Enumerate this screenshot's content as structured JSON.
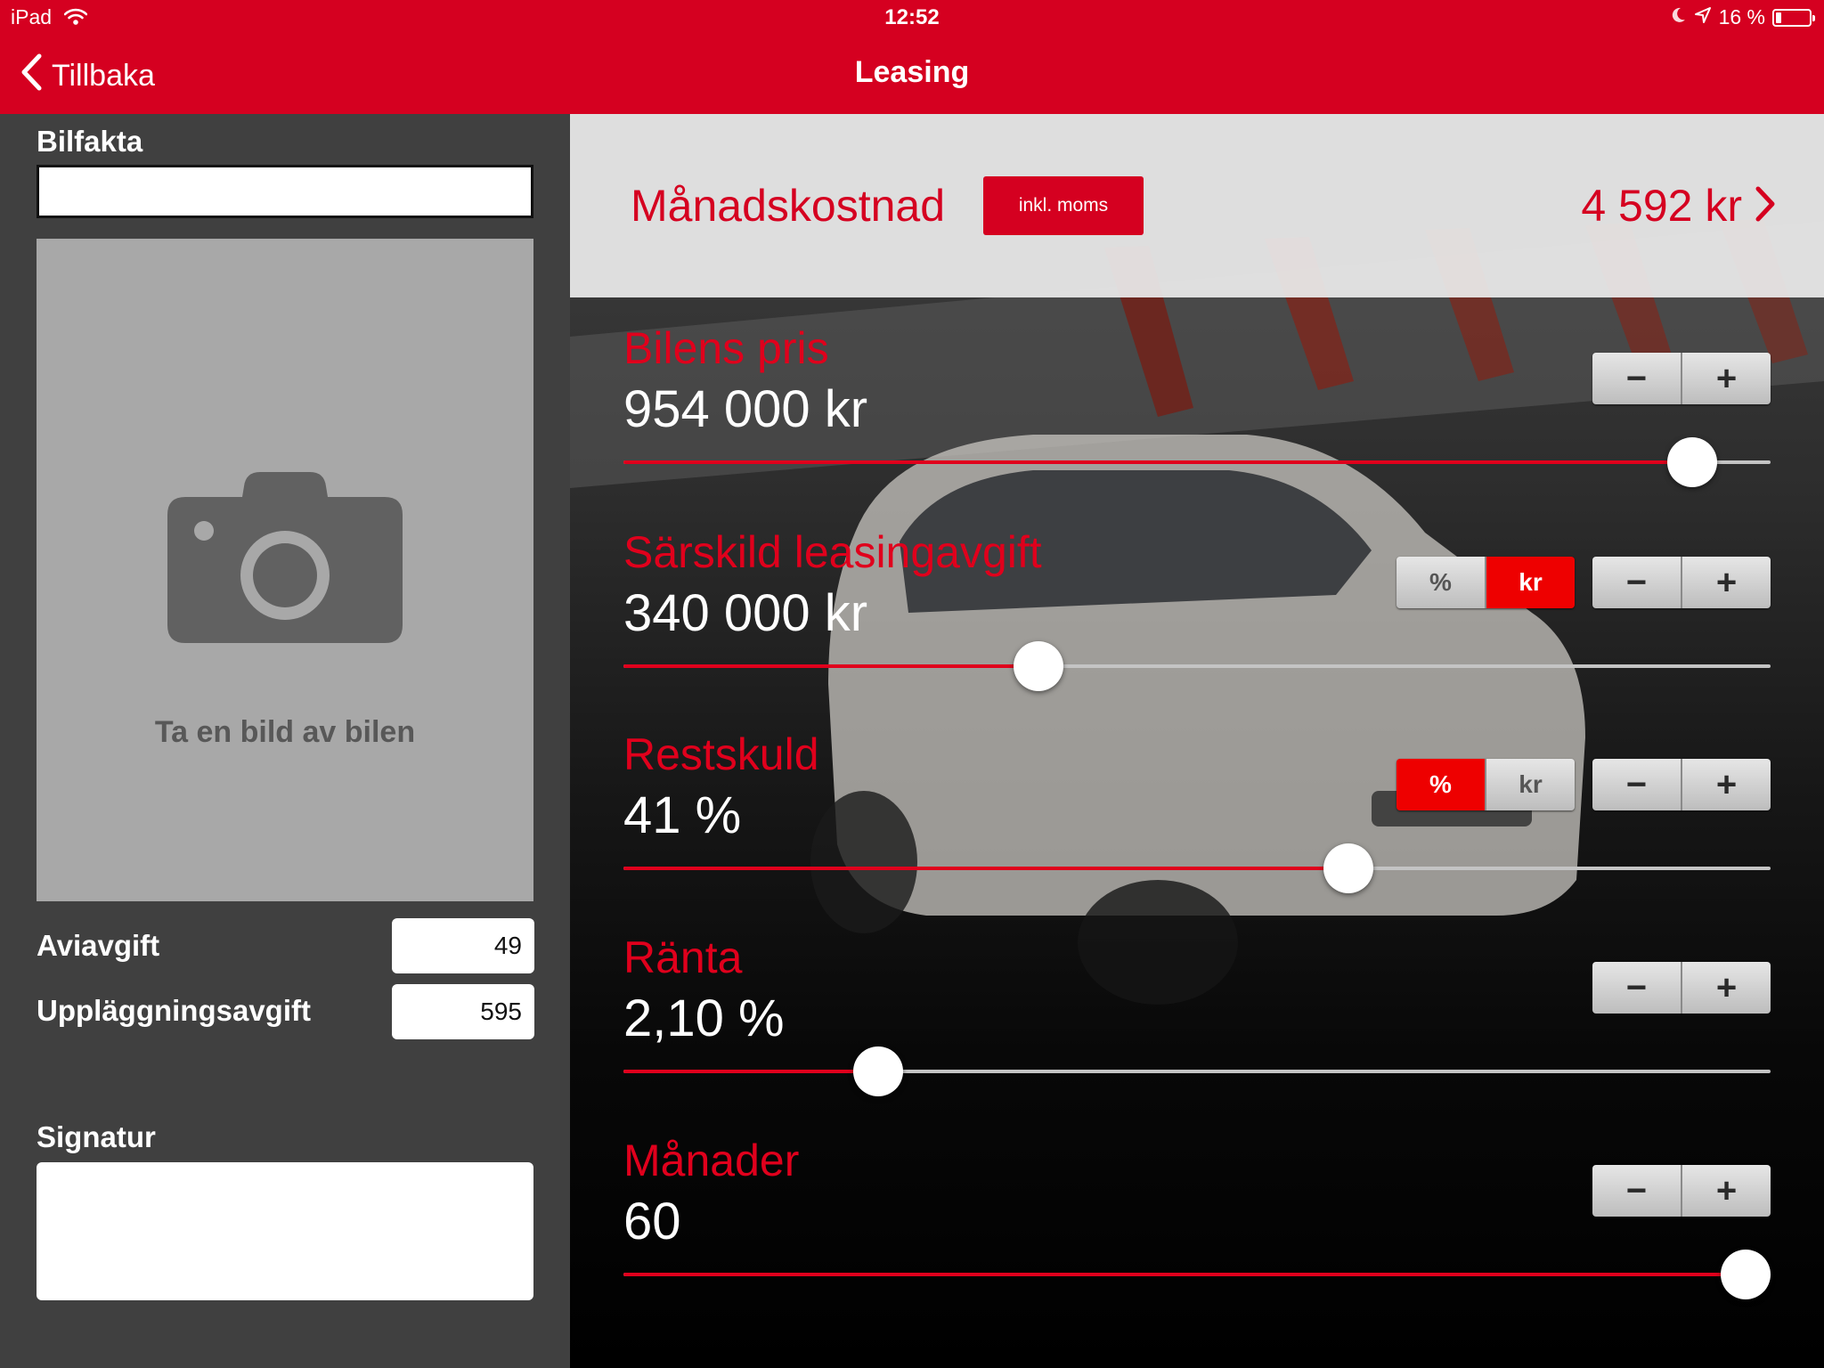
{
  "status_bar": {
    "device": "iPad",
    "time": "12:52",
    "battery_text": "16 %",
    "battery_level": 0.16
  },
  "nav": {
    "back_label": "Tillbaka",
    "title": "Leasing"
  },
  "left_panel": {
    "bilfakta_label": "Bilfakta",
    "bilfakta_value": "",
    "photo_caption": "Ta en bild av bilen",
    "aviavgift_label": "Aviavgift",
    "aviavgift_value": "49",
    "upplaggning_label": "Uppläggningsavgift",
    "upplaggning_value": "595",
    "signatur_label": "Signatur"
  },
  "summary": {
    "label": "Månadskostnad",
    "badge": "inkl. moms",
    "value": "4 592 kr"
  },
  "controls": [
    {
      "id": "bilens-pris",
      "label": "Bilens pris",
      "value": "954 000 kr",
      "slider": 0.932,
      "toggle": null
    },
    {
      "id": "sarskild-leasingavgift",
      "label": "Särskild leasingavgift",
      "value": "340 000 kr",
      "slider": 0.362,
      "toggle": {
        "options": [
          "%",
          "kr"
        ],
        "active": 1
      }
    },
    {
      "id": "restskuld",
      "label": "Restskuld",
      "value": "41 %",
      "slider": 0.632,
      "toggle": {
        "options": [
          "%",
          "kr"
        ],
        "active": 0
      }
    },
    {
      "id": "ranta",
      "label": "Ränta",
      "value": "2,10 %",
      "slider": 0.222,
      "toggle": null
    },
    {
      "id": "manader",
      "label": "Månader",
      "value": "60",
      "slider": 0.978,
      "toggle": null
    }
  ],
  "stepper": {
    "minus": "−",
    "plus": "+"
  },
  "colors": {
    "brand_red": "#d50020",
    "panel_gray": "#404040",
    "photo_gray": "#a8a8a8",
    "active_toggle": "#ee0000"
  },
  "icons": {
    "back": "chevron-left-icon",
    "wifi": "wifi-icon",
    "moon": "moon-icon",
    "location": "location-arrow-icon",
    "battery": "battery-icon",
    "camera": "camera-icon",
    "chevron": "chevron-right-icon"
  }
}
